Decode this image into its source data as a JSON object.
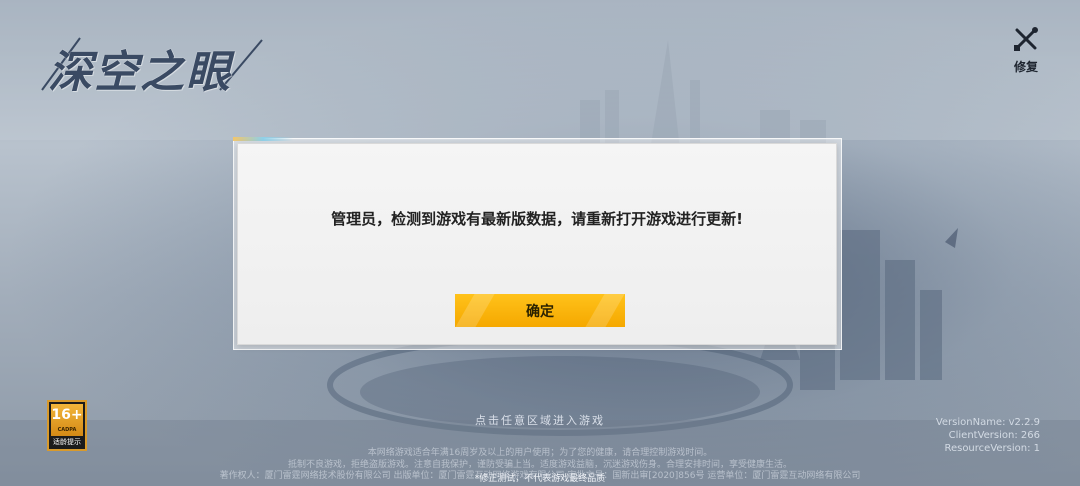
{
  "logo": {
    "text": "深空之眼"
  },
  "repair": {
    "label": "修复",
    "icon": "wrench-screwdriver-icon"
  },
  "dialog": {
    "message": "管理员，检测到游戏有最新版数据，请重新打开游戏进行更新!",
    "confirm_label": "确定"
  },
  "tap_hint": "点击任意区域进入游戏",
  "notices": [
    "本网络游戏适合年满16周岁及以上的用户使用；为了您的健康，请合理控制游戏时间。",
    "抵制不良游戏，拒绝盗版游戏。注意自我保护，谨防受骗上当。适度游戏益脑，沉迷游戏伤身。合理安排时间，享受健康生活。",
    "著作权人：厦门雷霆网络技术股份有限公司    出版单位：厦门雷霆互动网络游戏有限公司    审批文号：国新出审[2020]856号    运营单位：厦门雷霆互动网络有限公司"
  ],
  "test_note": "*修正测试，不代表游戏最终品质",
  "version": {
    "name": "VersionName: v2.2.9",
    "client": "ClientVersion: 266",
    "resource": "ResourceVersion: 1"
  },
  "age_badge": {
    "rating": "16+",
    "org": "CADPA",
    "label": "适龄提示"
  },
  "colors": {
    "button": "#f5a800",
    "dialog_bg": "#f2f2f2",
    "badge_border": "#d89a2c"
  }
}
